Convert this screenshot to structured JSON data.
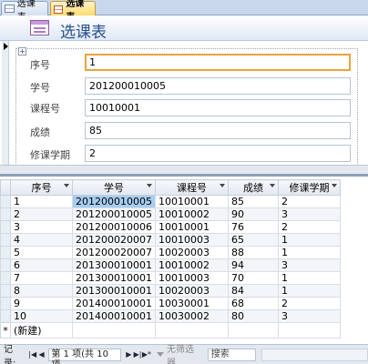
{
  "tabs": [
    {
      "label": "选课表",
      "active": false,
      "icon": "table-icon"
    },
    {
      "label": "选课表",
      "active": true,
      "icon": "form-icon"
    }
  ],
  "form": {
    "title": "选课表",
    "fields": [
      {
        "label": "序号",
        "value": "1"
      },
      {
        "label": "学号",
        "value": "201200010005"
      },
      {
        "label": "课程号",
        "value": "10010001"
      },
      {
        "label": "成绩",
        "value": "85"
      },
      {
        "label": "修课学期",
        "value": "2"
      }
    ]
  },
  "datasheet": {
    "columns": [
      "序号",
      "学号",
      "课程号",
      "成绩",
      "修课学期"
    ],
    "rows": [
      [
        "1",
        "201200010005",
        "10010001",
        "85",
        "2"
      ],
      [
        "2",
        "201200010005",
        "10010002",
        "90",
        "3"
      ],
      [
        "3",
        "201200010006",
        "10010001",
        "76",
        "2"
      ],
      [
        "4",
        "201200020007",
        "10010003",
        "65",
        "1"
      ],
      [
        "5",
        "201200020007",
        "10020003",
        "88",
        "1"
      ],
      [
        "6",
        "201300010001",
        "10010002",
        "94",
        "3"
      ],
      [
        "7",
        "201300010001",
        "10010003",
        "70",
        "1"
      ],
      [
        "8",
        "201300010001",
        "10020003",
        "84",
        "1"
      ],
      [
        "9",
        "201400010001",
        "10030001",
        "68",
        "2"
      ],
      [
        "10",
        "201400010001",
        "10030002",
        "80",
        "3"
      ]
    ],
    "new_row_marker": "*",
    "new_row_label": "(新建)"
  },
  "navbar": {
    "record_label": "记录:",
    "position_text": "第 1 项(共 10 项",
    "filter_label": "无筛选器",
    "search_label": "搜索"
  },
  "colors": {
    "accent": "#25508e",
    "selection": "#a7cdf0",
    "active_field_border": "#e8a43c"
  }
}
